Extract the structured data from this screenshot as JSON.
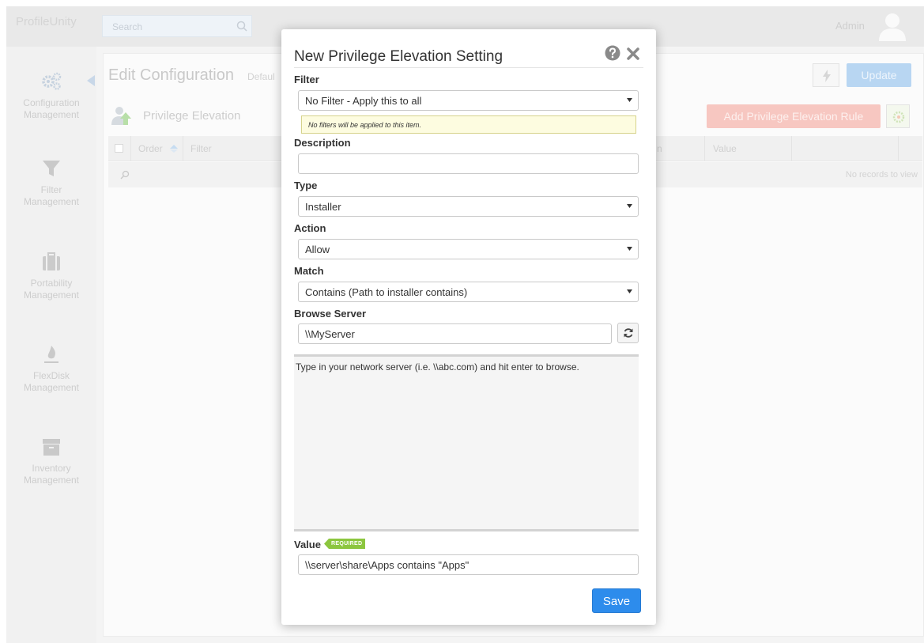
{
  "app": {
    "brand": "ProfileUnity",
    "search_placeholder": "Search",
    "user_name": "Admin"
  },
  "sidebar": {
    "items": [
      {
        "label_line1": "Configuration",
        "label_line2": "Management",
        "icon": "gears-icon"
      },
      {
        "label_line1": "Filter",
        "label_line2": "Management",
        "icon": "funnel-icon"
      },
      {
        "label_line1": "Portability",
        "label_line2": "Management",
        "icon": "briefcase-icon"
      },
      {
        "label_line1": "FlexDisk",
        "label_line2": "Management",
        "icon": "flame-icon"
      },
      {
        "label_line1": "Inventory",
        "label_line2": "Management",
        "icon": "archive-icon"
      }
    ]
  },
  "page": {
    "title": "Edit Configuration",
    "subtitle_fragment": "Defaul",
    "update_label": "Update",
    "section_title": "Privilege Elevation",
    "add_rule_label": "Add Privilege Elevation Rule",
    "grid": {
      "columns": [
        "Order",
        "Filter",
        "n",
        "Value"
      ],
      "empty_text": "No records to view"
    }
  },
  "modal": {
    "title": "New Privilege Elevation Setting",
    "filter": {
      "label": "Filter",
      "value": "No Filter - Apply this to all",
      "hint": "No filters will be applied to this item."
    },
    "description": {
      "label": "Description",
      "value": ""
    },
    "type": {
      "label": "Type",
      "value": "Installer"
    },
    "action": {
      "label": "Action",
      "value": "Allow"
    },
    "match": {
      "label": "Match",
      "value": "Contains (Path to installer contains)"
    },
    "browse": {
      "label": "Browse Server",
      "value": "\\\\MyServer",
      "help_text": "Type in your network server (i.e. \\\\abc.com) and hit enter to browse."
    },
    "value_field": {
      "label": "Value",
      "badge": "REQUIRED",
      "value": "\\\\server\\share\\Apps contains \"Apps\""
    },
    "save_label": "Save"
  },
  "colors": {
    "primary": "#2d8cec",
    "required_badge": "#8cc63f",
    "hint_bg": "#fdfce0",
    "add_rule_faded": "#f7c7c1",
    "update_faded": "#b8d6f2"
  }
}
